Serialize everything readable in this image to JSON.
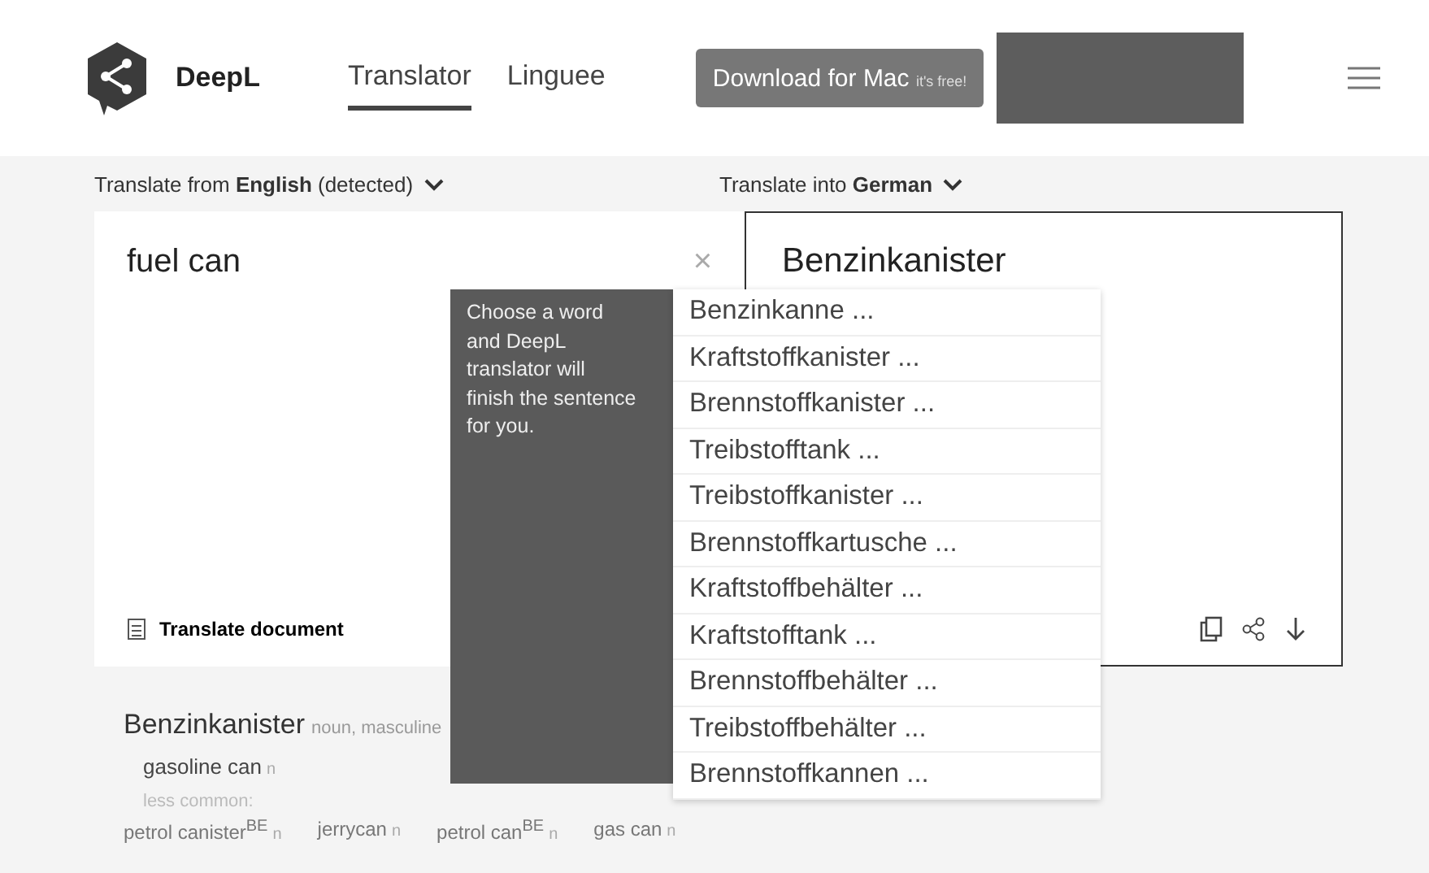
{
  "header": {
    "brand": "DeepL",
    "tabs": [
      {
        "label": "Translator",
        "selected": true
      },
      {
        "label": "Linguee",
        "selected": false
      }
    ],
    "download_button": {
      "label": "Download for Mac",
      "note": "it's free!"
    }
  },
  "source": {
    "label": "Translate from",
    "language": "English",
    "detected": "(detected)",
    "text": "fuel can",
    "close": "×",
    "document_button": "Translate document"
  },
  "target": {
    "label": "Translate into",
    "language": "German",
    "text": "Benzinkanister"
  },
  "tooltip": "Choose a word and DeepL translator will finish the sentence for you.",
  "alternatives": [
    "Benzinkanne ...",
    "Kraftstoffkanister ...",
    "Brennstoffkanister ...",
    "Treibstofftank ...",
    "Treibstoffkanister ...",
    "Brennstoffkartusche ...",
    "Kraftstoffbehälter ...",
    "Kraftstofftank ...",
    "Brennstoffbehälter ...",
    "Treibstoffbehälter ...",
    "Brennstoffkannen ..."
  ],
  "dictionary": {
    "headword": "Benzinkanister",
    "grammar": "noun, masculine",
    "main": [
      {
        "term": "gasoline can",
        "pos": "n"
      }
    ],
    "less_common_label": "less common:",
    "less_common": [
      {
        "term": "petrol canister$^{BE}$",
        "pos": "n"
      },
      {
        "term": "jerrycan",
        "pos": "n"
      },
      {
        "term": "petrol can$^{BE}$",
        "pos": "n"
      },
      {
        "term": "gas can",
        "pos": "n"
      }
    ]
  }
}
